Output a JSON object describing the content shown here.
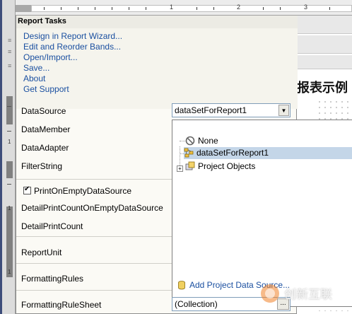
{
  "top_ruler": {
    "numbers": [
      "1",
      "2",
      "3"
    ]
  },
  "left_ruler": {
    "numbers": [
      "1",
      "1",
      "1"
    ]
  },
  "report": {
    "title": "报表示例"
  },
  "panel": {
    "title": "Report Tasks",
    "links": [
      "Design in Report Wizard...",
      "Edit and Reorder Bands...",
      "Open/Import...",
      "Save...",
      "About",
      "Get Support"
    ],
    "properties": {
      "datasource": "DataSource",
      "datamember": "DataMember",
      "dataadapter": "DataAdapter",
      "filterstring": "FilterString",
      "print_on_empty": "PrintOnEmptyDataSource",
      "detail_count_empty": "DetailPrintCountOnEmptyDataSource",
      "detail_count": "DetailPrintCount",
      "report_unit": "ReportUnit",
      "formatting_rules": "FormattingRules",
      "formatting_rule_sheet": "FormattingRuleSheet"
    },
    "print_on_empty_checked": true
  },
  "datasource_combo": {
    "value": "dataSetForReport1",
    "arrow": "▼"
  },
  "dropdown": {
    "items": [
      "None",
      "dataSetForReport1",
      "Project Objects"
    ],
    "expander": "+",
    "add_label": "Add Project Data Source..."
  },
  "formatting_rule_sheet_field": {
    "value": "(Collection)",
    "button": "..."
  },
  "colors": {
    "link": "#1a4fa0",
    "selection": "#c4d6e8"
  }
}
